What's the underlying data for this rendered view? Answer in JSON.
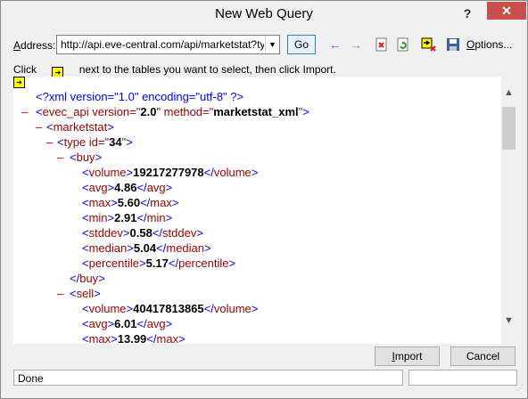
{
  "window": {
    "title": "New Web Query",
    "help_label": "?",
    "close_label": "✕"
  },
  "address": {
    "label_prefix": "",
    "label_underlined": "A",
    "label_rest": "ddress:",
    "value": "http://api.eve-central.com/api/marketstat?typ",
    "go_label": "Go"
  },
  "toolbar": {
    "back_icon": "←",
    "forward_icon": "→",
    "stop_icon": "✕",
    "refresh_icon": "⟳",
    "hide_icons_icon": "➡",
    "save_icon": "💾",
    "options_label": "Options..."
  },
  "instructions": {
    "part1": "Click",
    "part2": "next to the tables you want to select, then click Import."
  },
  "xml": {
    "decl": "<?xml version=\"1.0\" encoding=\"utf-8\" ?>",
    "evec_open": "<evec_api version=\"",
    "evec_version": "2.0",
    "evec_mid": "\" method=\"",
    "evec_method": "marketstat_xml",
    "evec_close": "\">",
    "marketstat": "<marketstat>",
    "type_open": "<type id=\"",
    "type_id": "34",
    "type_close": "\">",
    "buy_open": "<buy>",
    "buy_close": "</buy>",
    "sell_open": "<sell>",
    "buy": [
      {
        "tag": "volume",
        "value": "19217277978"
      },
      {
        "tag": "avg",
        "value": "4.86"
      },
      {
        "tag": "max",
        "value": "5.60"
      },
      {
        "tag": "min",
        "value": "2.91"
      },
      {
        "tag": "stddev",
        "value": "0.58"
      },
      {
        "tag": "median",
        "value": "5.04"
      },
      {
        "tag": "percentile",
        "value": "5.17"
      }
    ],
    "sell": [
      {
        "tag": "volume",
        "value": "40417813865"
      },
      {
        "tag": "avg",
        "value": "6.01"
      },
      {
        "tag": "max",
        "value": "13.99"
      }
    ]
  },
  "buttons": {
    "import_label": "Import",
    "import_accel": "I",
    "cancel_label": "Cancel"
  },
  "status": {
    "text": "Done"
  },
  "colors": {
    "close_button": "#c7504a",
    "tag": "#990000",
    "minus": "#c00000",
    "go_border": "#3c7fb1"
  }
}
